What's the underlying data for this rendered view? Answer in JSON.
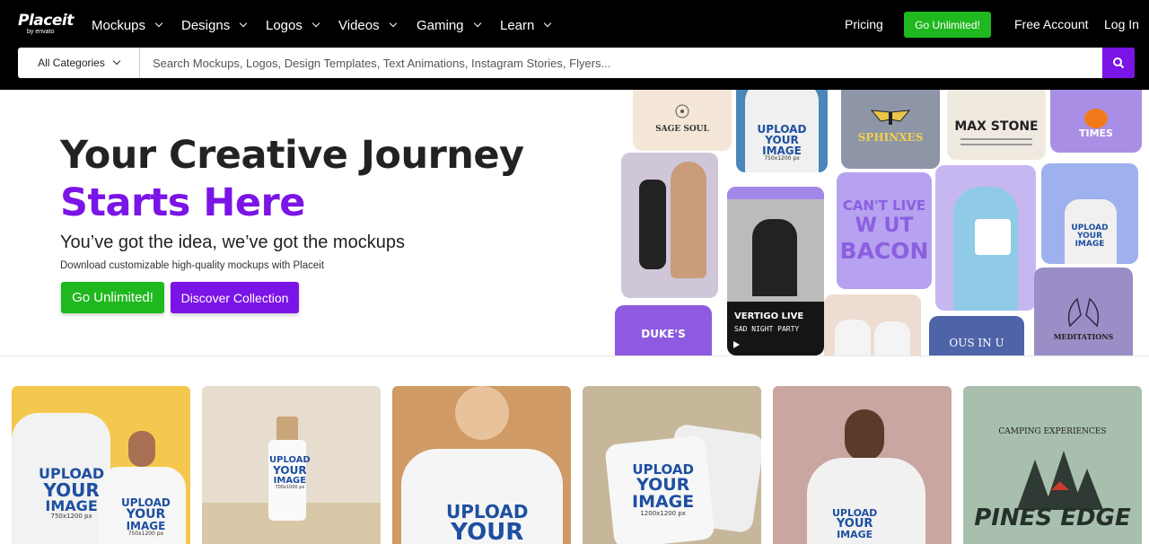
{
  "header": {
    "logo": {
      "name": "Placeit",
      "by": "by envato"
    },
    "nav": [
      {
        "label": "Mockups"
      },
      {
        "label": "Designs"
      },
      {
        "label": "Logos"
      },
      {
        "label": "Videos"
      },
      {
        "label": "Gaming"
      },
      {
        "label": "Learn"
      }
    ],
    "pricing": "Pricing",
    "go_unlimited": "Go Unlimited!",
    "free_account": "Free Account",
    "login": "Log In"
  },
  "search": {
    "category": "All Categories",
    "placeholder": "Search Mockups, Logos, Design Templates, Text Animations, Instagram Stories, Flyers..."
  },
  "hero": {
    "title_line1": "Your Creative Journey",
    "title_line2": "Starts Here",
    "subtitle": "You’ve got the idea, we’ve got the mockups",
    "description": "Download customizable high-quality mockups with Placeit",
    "cta_primary": "Go Unlimited!",
    "cta_secondary": "Discover Collection"
  },
  "collage": {
    "sage_soul": "SAGE SOUL",
    "sphinxes": "SPHINXES",
    "max_stone": "MAX STONE",
    "times": "TIMES",
    "cant_live": "CAN'T LIVE",
    "without": "W   UT",
    "bacon": "BACON",
    "vertigo": "VERTIGO LIVE",
    "sad_night": "SAD NIGHT PARTY",
    "dukes": "DUKE'S",
    "meditations": "MEDITATIONS",
    "upload": "UPLOAD",
    "your": "YOUR",
    "image": "IMAGE",
    "size": "750x1200 px",
    "arc": "OUS IN U"
  },
  "cards": {
    "upload": "UPLOAD",
    "your": "YOUR",
    "image": "IMAGE",
    "size_a": "750x1200 px",
    "size_b": "700x1000 px",
    "size_c": "1200x1200 px",
    "camping": "CAMPING EXPERIENCES",
    "pines": "PINES EDGE"
  },
  "colors": {
    "brand_purple": "#7b14e6",
    "brand_green": "#1fb81f",
    "header_bg": "#000000"
  }
}
